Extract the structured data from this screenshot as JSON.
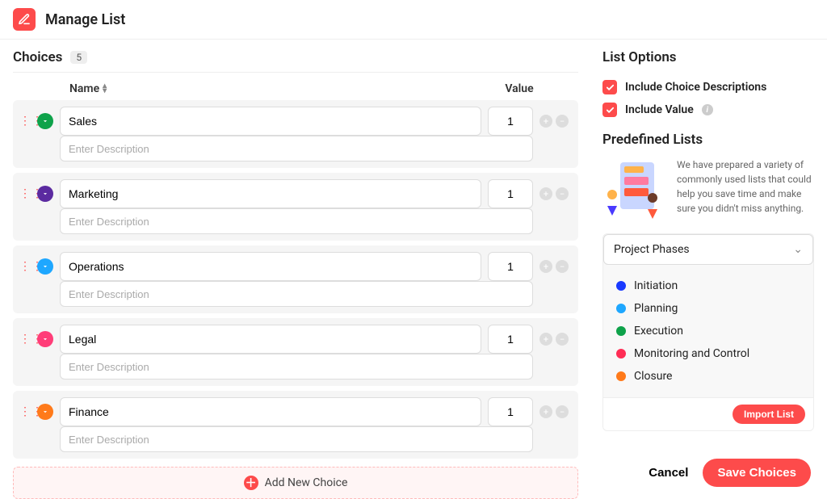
{
  "header": {
    "title": "Manage List"
  },
  "choices": {
    "title": "Choices",
    "count": "5",
    "columns": {
      "name": "Name",
      "value": "Value"
    },
    "desc_placeholder": "Enter Description",
    "items": [
      {
        "name": "Sales",
        "value": "1",
        "color": "#0ea24a"
      },
      {
        "name": "Marketing",
        "value": "1",
        "color": "#5b2aa0"
      },
      {
        "name": "Operations",
        "value": "1",
        "color": "#1ea7ff"
      },
      {
        "name": "Legal",
        "value": "1",
        "color": "#ff3d78"
      },
      {
        "name": "Finance",
        "value": "1",
        "color": "#ff7a1a"
      }
    ],
    "add_label": "Add New Choice"
  },
  "options": {
    "title": "List Options",
    "include_desc": "Include Choice Descriptions",
    "include_value": "Include Value"
  },
  "predefined": {
    "title": "Predefined Lists",
    "intro": "We have prepared a variety of commonly used lists that could help you save time and make sure you didn't miss anything.",
    "selected": "Project Phases",
    "items": [
      {
        "label": "Initiation",
        "color": "#1939ff"
      },
      {
        "label": "Planning",
        "color": "#1ea7ff"
      },
      {
        "label": "Execution",
        "color": "#0ea24a"
      },
      {
        "label": "Monitoring and Control",
        "color": "#ff2d55"
      },
      {
        "label": "Closure",
        "color": "#ff7a1a"
      }
    ],
    "import": "Import List"
  },
  "footer": {
    "cancel": "Cancel",
    "save": "Save Choices"
  }
}
